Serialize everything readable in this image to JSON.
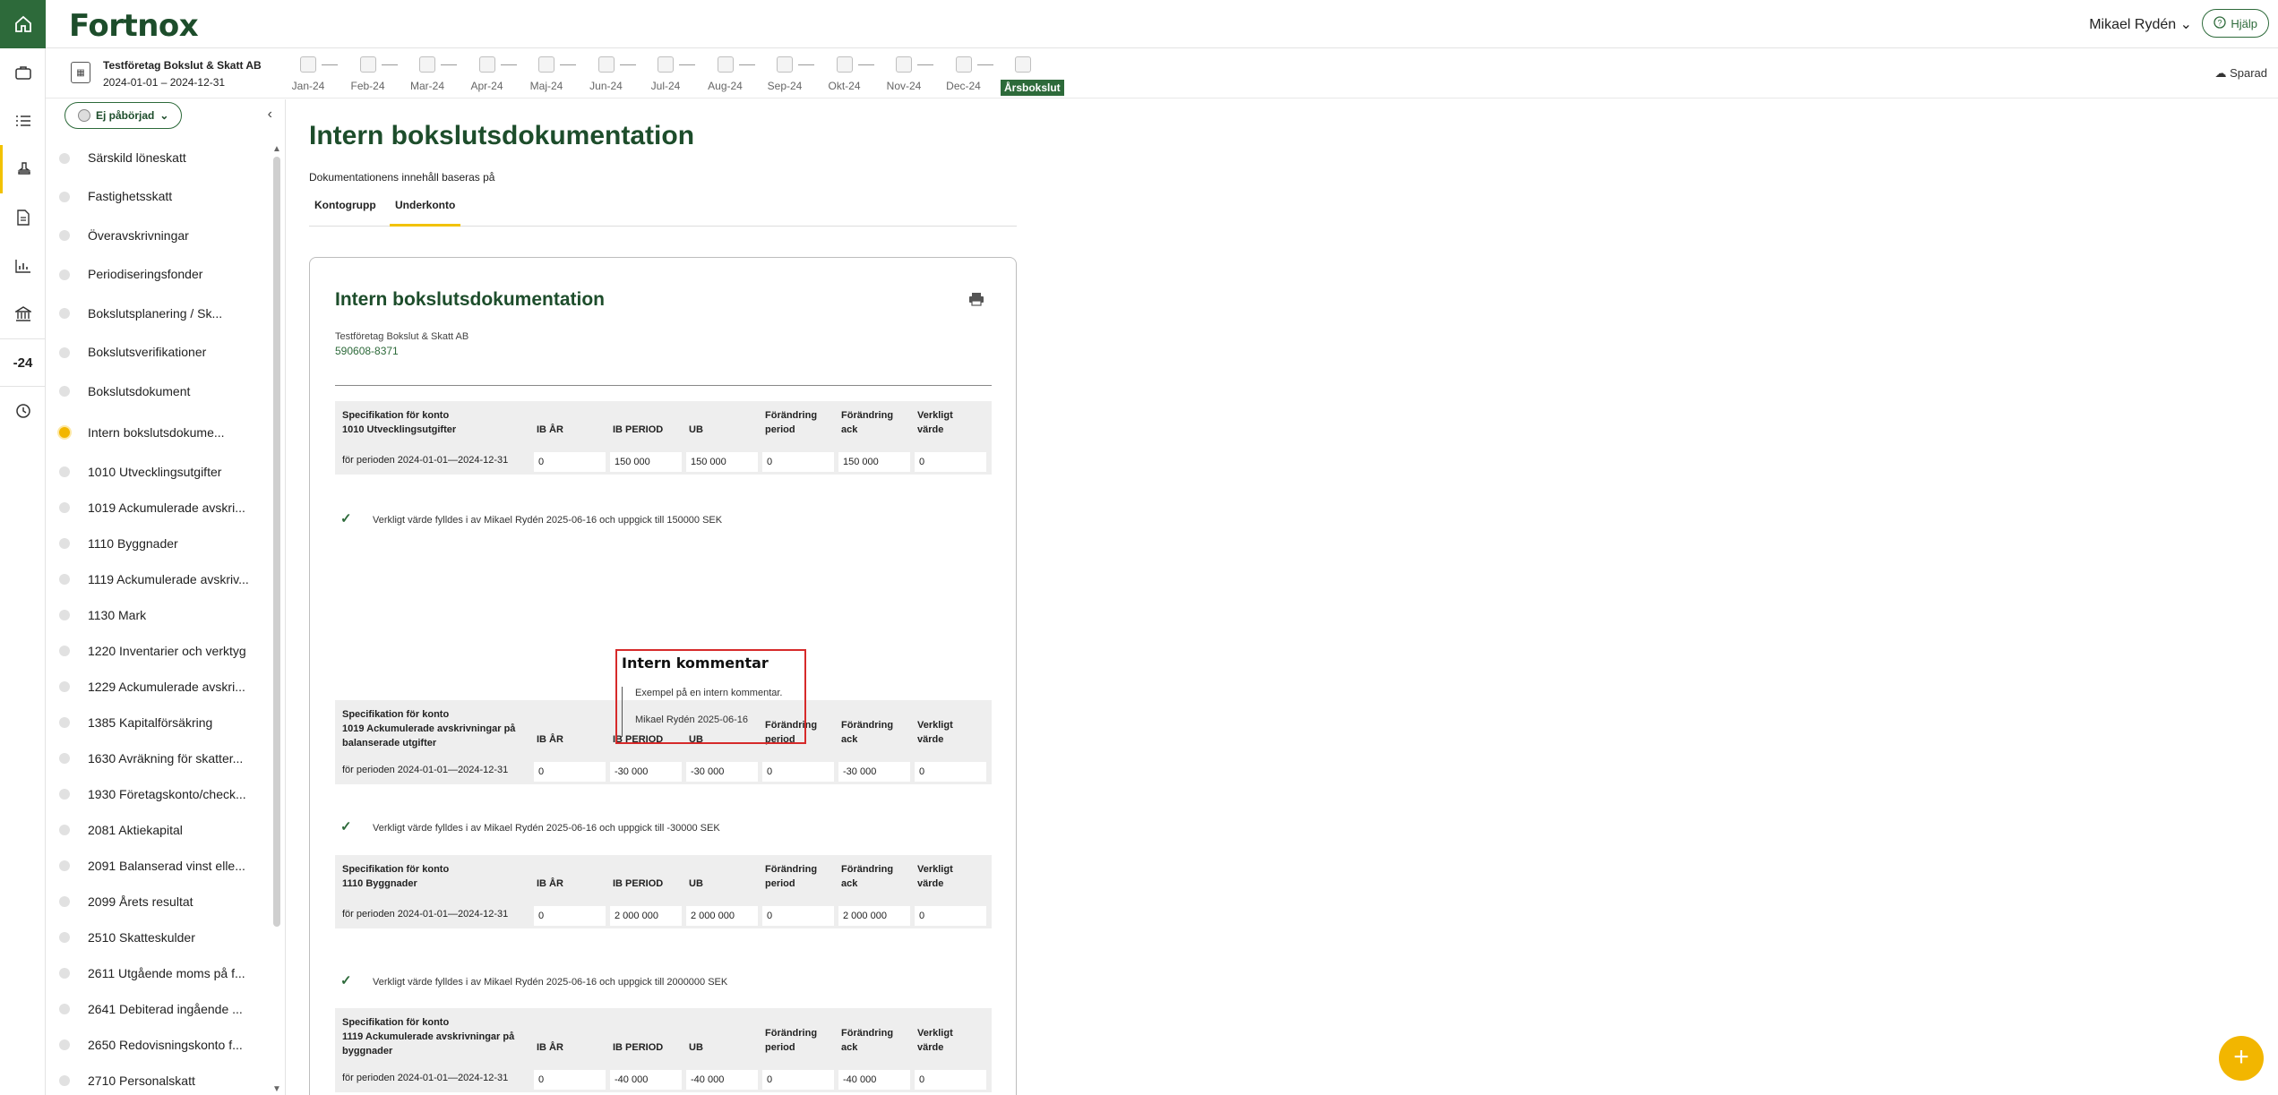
{
  "app": {
    "logo": "Fortnox",
    "user_name": "Mikael Rydén ⌄",
    "help_label": "Hjälp",
    "year_label": "-24",
    "saved_label": "Sparad"
  },
  "company": {
    "name": "Testföretag Bokslut & Skatt AB",
    "dates": "2024-01-01 – 2024-12-31"
  },
  "months": [
    "Jan-24",
    "Feb-24",
    "Mar-24",
    "Apr-24",
    "Maj-24",
    "Jun-24",
    "Jul-24",
    "Aug-24",
    "Sep-24",
    "Okt-24",
    "Nov-24",
    "Dec-24",
    "Årsbokslut"
  ],
  "sidebar": {
    "status": "Ej påbörjad",
    "items": [
      {
        "label": "Särskild löneskatt"
      },
      {
        "label": "Fastighetsskatt"
      },
      {
        "label": "Överavskrivningar"
      },
      {
        "label": "Periodiseringsfonder"
      },
      {
        "label": "Bokslutsplanering / Sk..."
      },
      {
        "label": "Bokslutsverifikationer"
      },
      {
        "label": "Bokslutsdokument"
      },
      {
        "label": "Intern bokslutsdokume..."
      },
      {
        "label": "1010 Utvecklingsutgifter"
      },
      {
        "label": "1019 Ackumulerade avskri..."
      },
      {
        "label": "1110 Byggnader"
      },
      {
        "label": "1119 Ackumulerade avskriv..."
      },
      {
        "label": "1130 Mark"
      },
      {
        "label": "1220 Inventarier och verktyg"
      },
      {
        "label": "1229 Ackumulerade avskri..."
      },
      {
        "label": "1385 Kapitalförsäkring"
      },
      {
        "label": "1630 Avräkning för skatter..."
      },
      {
        "label": "1930 Företagskonto/check..."
      },
      {
        "label": "2081 Aktiekapital"
      },
      {
        "label": "2091 Balanserad vinst elle..."
      },
      {
        "label": "2099 Årets resultat"
      },
      {
        "label": "2510 Skatteskulder"
      },
      {
        "label": "2611 Utgående moms på f..."
      },
      {
        "label": "2641 Debiterad ingående ..."
      },
      {
        "label": "2650 Redovisningskonto f..."
      },
      {
        "label": "2710 Personalskatt"
      }
    ]
  },
  "main": {
    "title": "Intern bokslutsdokumentation",
    "basis_label": "Dokumentationens innehåll baseras på",
    "tabs": [
      "Kontogrupp",
      "Underkonto"
    ],
    "card": {
      "title": "Intern bokslutsdokumentation",
      "company": "Testföretag Bokslut & Skatt AB",
      "orgnr": "590608-8371",
      "columns": {
        "ib_ar": "IB ÅR",
        "ib_period": "IB PERIOD",
        "ub": "UB",
        "forandring_period": "Förändring\nperiod",
        "forandring_ack": "Förändring\nack",
        "verkligt_varde": "Verkligt\nvärde"
      },
      "specs": [
        {
          "label": "Specifikation för konto\n1010 Utvecklingsutgifter",
          "period": "för perioden 2024-01-01—2024-12-31",
          "values": [
            "0",
            "150 000",
            "150 000",
            "0",
            "150 000",
            "0"
          ],
          "verify": "Verkligt värde fylldes i av Mikael Rydén 2025-06-16 och uppgick till 150000 SEK"
        },
        {
          "label": "Specifikation för konto\n1019 Ackumulerade avskrivningar på\nbalanserade utgifter",
          "period": "för perioden 2024-01-01—2024-12-31",
          "values": [
            "0",
            "-30 000",
            "-30 000",
            "0",
            "-30 000",
            "0"
          ],
          "verify": "Verkligt värde fylldes i av Mikael Rydén 2025-06-16 och uppgick till -30000 SEK"
        },
        {
          "label": "Specifikation för konto\n1110 Byggnader",
          "period": "för perioden 2024-01-01—2024-12-31",
          "values": [
            "0",
            "2 000 000",
            "2 000 000",
            "0",
            "2 000 000",
            "0"
          ],
          "verify": "Verkligt värde fylldes i av Mikael Rydén 2025-06-16 och uppgick till 2000000 SEK"
        },
        {
          "label": "Specifikation för konto\n1119 Ackumulerade avskrivningar på\nbyggnader",
          "period": "för perioden 2024-01-01—2024-12-31",
          "values": [
            "0",
            "-40 000",
            "-40 000",
            "0",
            "-40 000",
            "0"
          ],
          "verify": ""
        }
      ],
      "comment": {
        "title": "Intern kommentar",
        "text": "Exempel på en intern kommentar.",
        "author": "Mikael Rydén 2025-06-16"
      }
    }
  },
  "colors": {
    "brand": "#1d4d2b",
    "accent": "#f2c200",
    "highlight": "#d62a2a"
  }
}
